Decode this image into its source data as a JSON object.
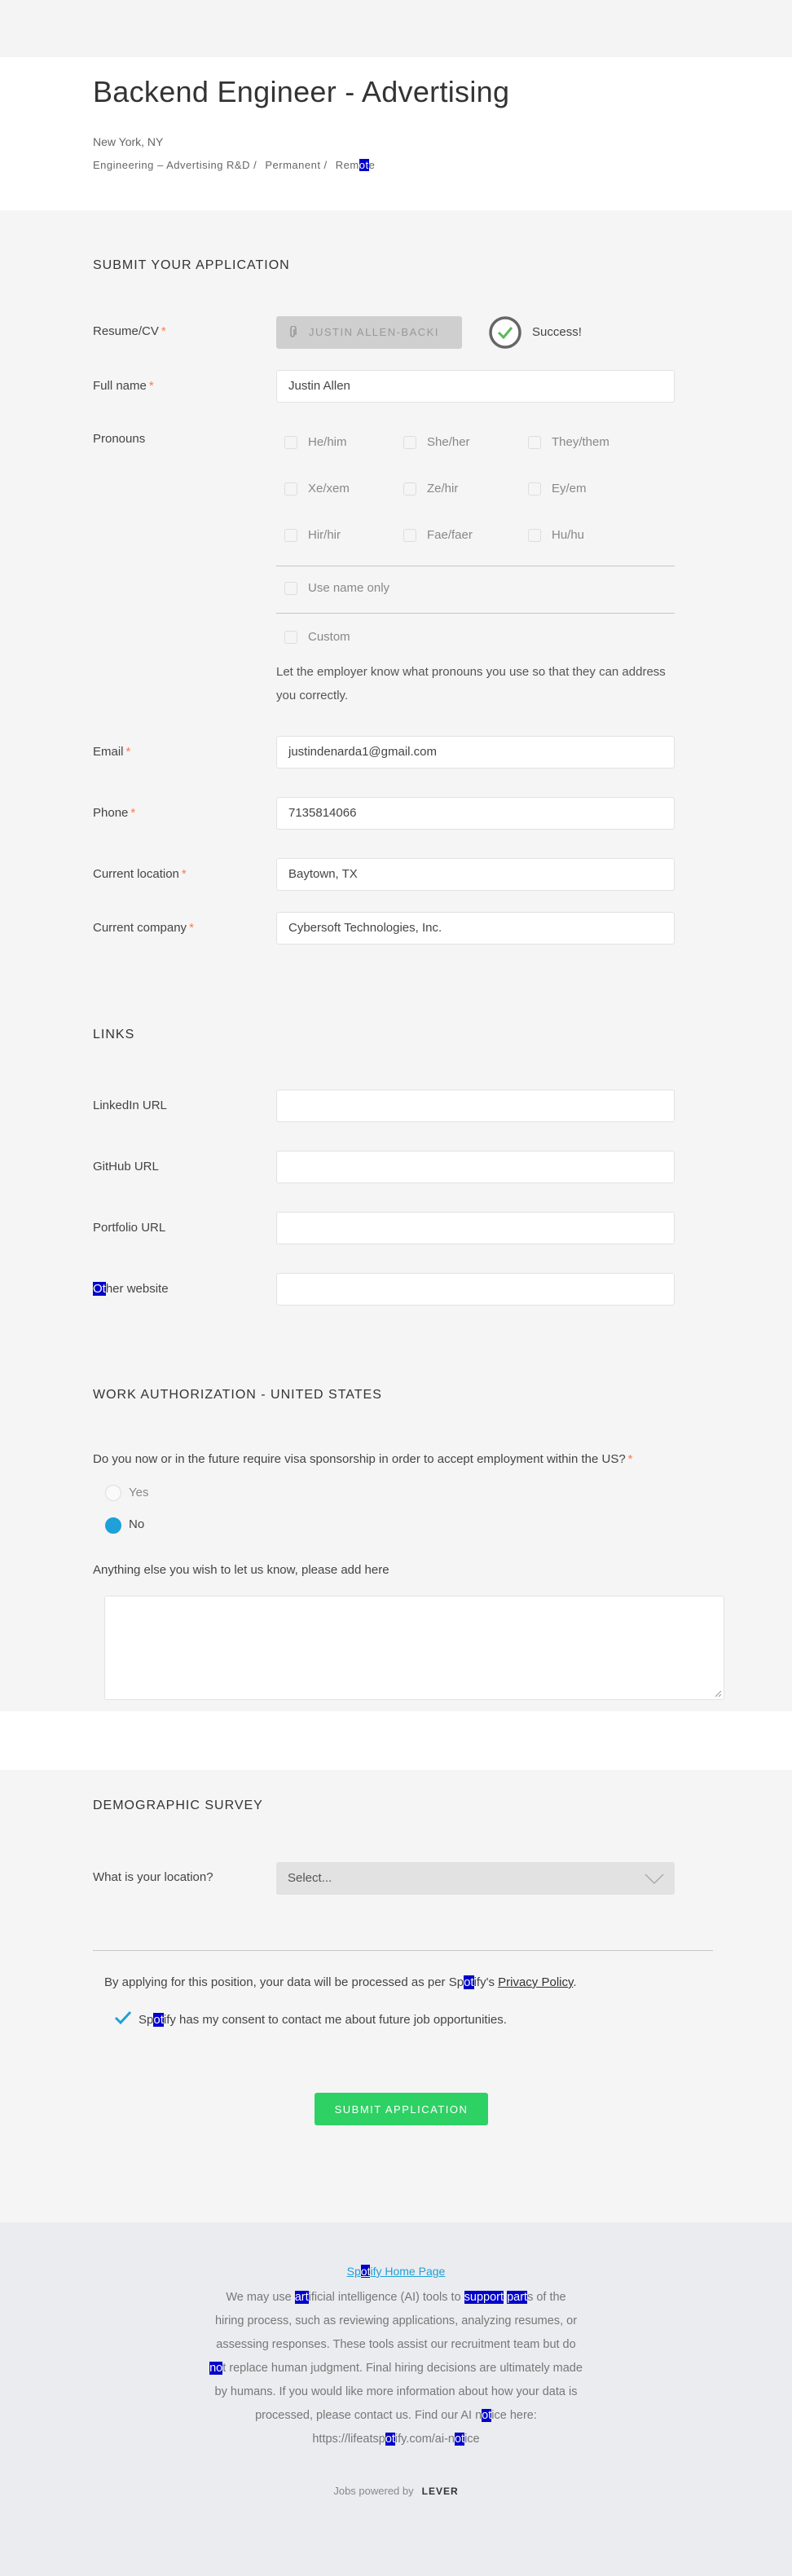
{
  "job": {
    "title": "Backend Engineer - Advertising",
    "location": "New York, NY",
    "team": "Engineering – Advertising R&D /",
    "commitment": "Permanent /",
    "workplace": {
      "pre": "Rem",
      "hl": "ot",
      "post": "e"
    }
  },
  "application": {
    "heading": "Submit your application",
    "resume": {
      "label": "Resume/CV",
      "button": "JUSTIN ALLEN-BACKI",
      "status": "Success!"
    },
    "full_name": {
      "label": "Full name",
      "value": "Justin Allen"
    },
    "pronouns": {
      "label": "Pronouns",
      "options": [
        "He/him",
        "She/her",
        "They/them",
        "Xe/xem",
        "Ze/hir",
        "Ey/em",
        "Hir/hir",
        "Fae/faer",
        "Hu/hu"
      ],
      "use_name": "Use name only",
      "custom": "Custom",
      "hint": "Let the employer know what pronouns you use so that they can address you correctly."
    },
    "email": {
      "label": "Email",
      "value": "justindenarda1@gmail.com"
    },
    "phone": {
      "label": "Phone",
      "value": "7135814066"
    },
    "location": {
      "label": "Current location",
      "value": "Baytown, TX"
    },
    "company": {
      "label": "Current company",
      "value": "Cybersoft Technologies, Inc."
    },
    "required_mark": "*"
  },
  "links": {
    "heading": "Links",
    "linkedin": "LinkedIn URL",
    "github": "GitHub URL",
    "portfolio": "Portfolio URL",
    "other": {
      "hl": "Ot",
      "post": "her website"
    }
  },
  "work_auth": {
    "heading": "Work authorization - United States",
    "question": "Do you now or in the future require visa sponsorship in order to accept employment within the US?",
    "yes": "Yes",
    "no": "No",
    "selected": "No",
    "extra_label": "Anything else you wish to let us know, please add here"
  },
  "demographic": {
    "heading": "Demographic survey",
    "question": "What is your location?",
    "select_value": "Select..."
  },
  "consent": {
    "policy_pre": "By applying for this position, your data will be processed as per Sp",
    "policy_hl": "ot",
    "policy_mid": "ify's ",
    "policy_link": "Privacy Policy",
    "policy_post": ".",
    "contact_pre": "Sp",
    "contact_hl": "ot",
    "contact_post": "ify has my consent to contact me about future job opportunities.",
    "checked": true
  },
  "submit_label": "Submit application",
  "footer": {
    "home_link": {
      "pre": "Sp",
      "hl": "ot",
      "post": "ify Home Page"
    },
    "ai_notice": [
      [
        "We may use ",
        "art",
        "ificial intelligence (AI) tools to ",
        "support",
        " ",
        "part",
        "s of the"
      ],
      [
        "hiring process, such as reviewing applications, analyzing resumes, or"
      ],
      [
        "assessing responses. These tools assist our recruitment team but do"
      ],
      [
        "",
        "no",
        "t replace human judgment. Final hiring decisions are ultimately made"
      ],
      [
        "by humans. If you would like more information about how your data is"
      ],
      [
        "processed, please contact us. Find our AI n",
        "ot",
        "ice here:"
      ],
      [
        "https://lifeatsp",
        "ot",
        "ify.com/ai-n",
        "ot",
        "ice"
      ]
    ],
    "powered_by": "Jobs powered by",
    "powered_brand": "LEVER"
  },
  "colors": {
    "accent": "#1ea0d9",
    "submit": "#2ed164",
    "required": "#ff794f",
    "success": "#5cb85c",
    "highlight": "#0000cc"
  }
}
